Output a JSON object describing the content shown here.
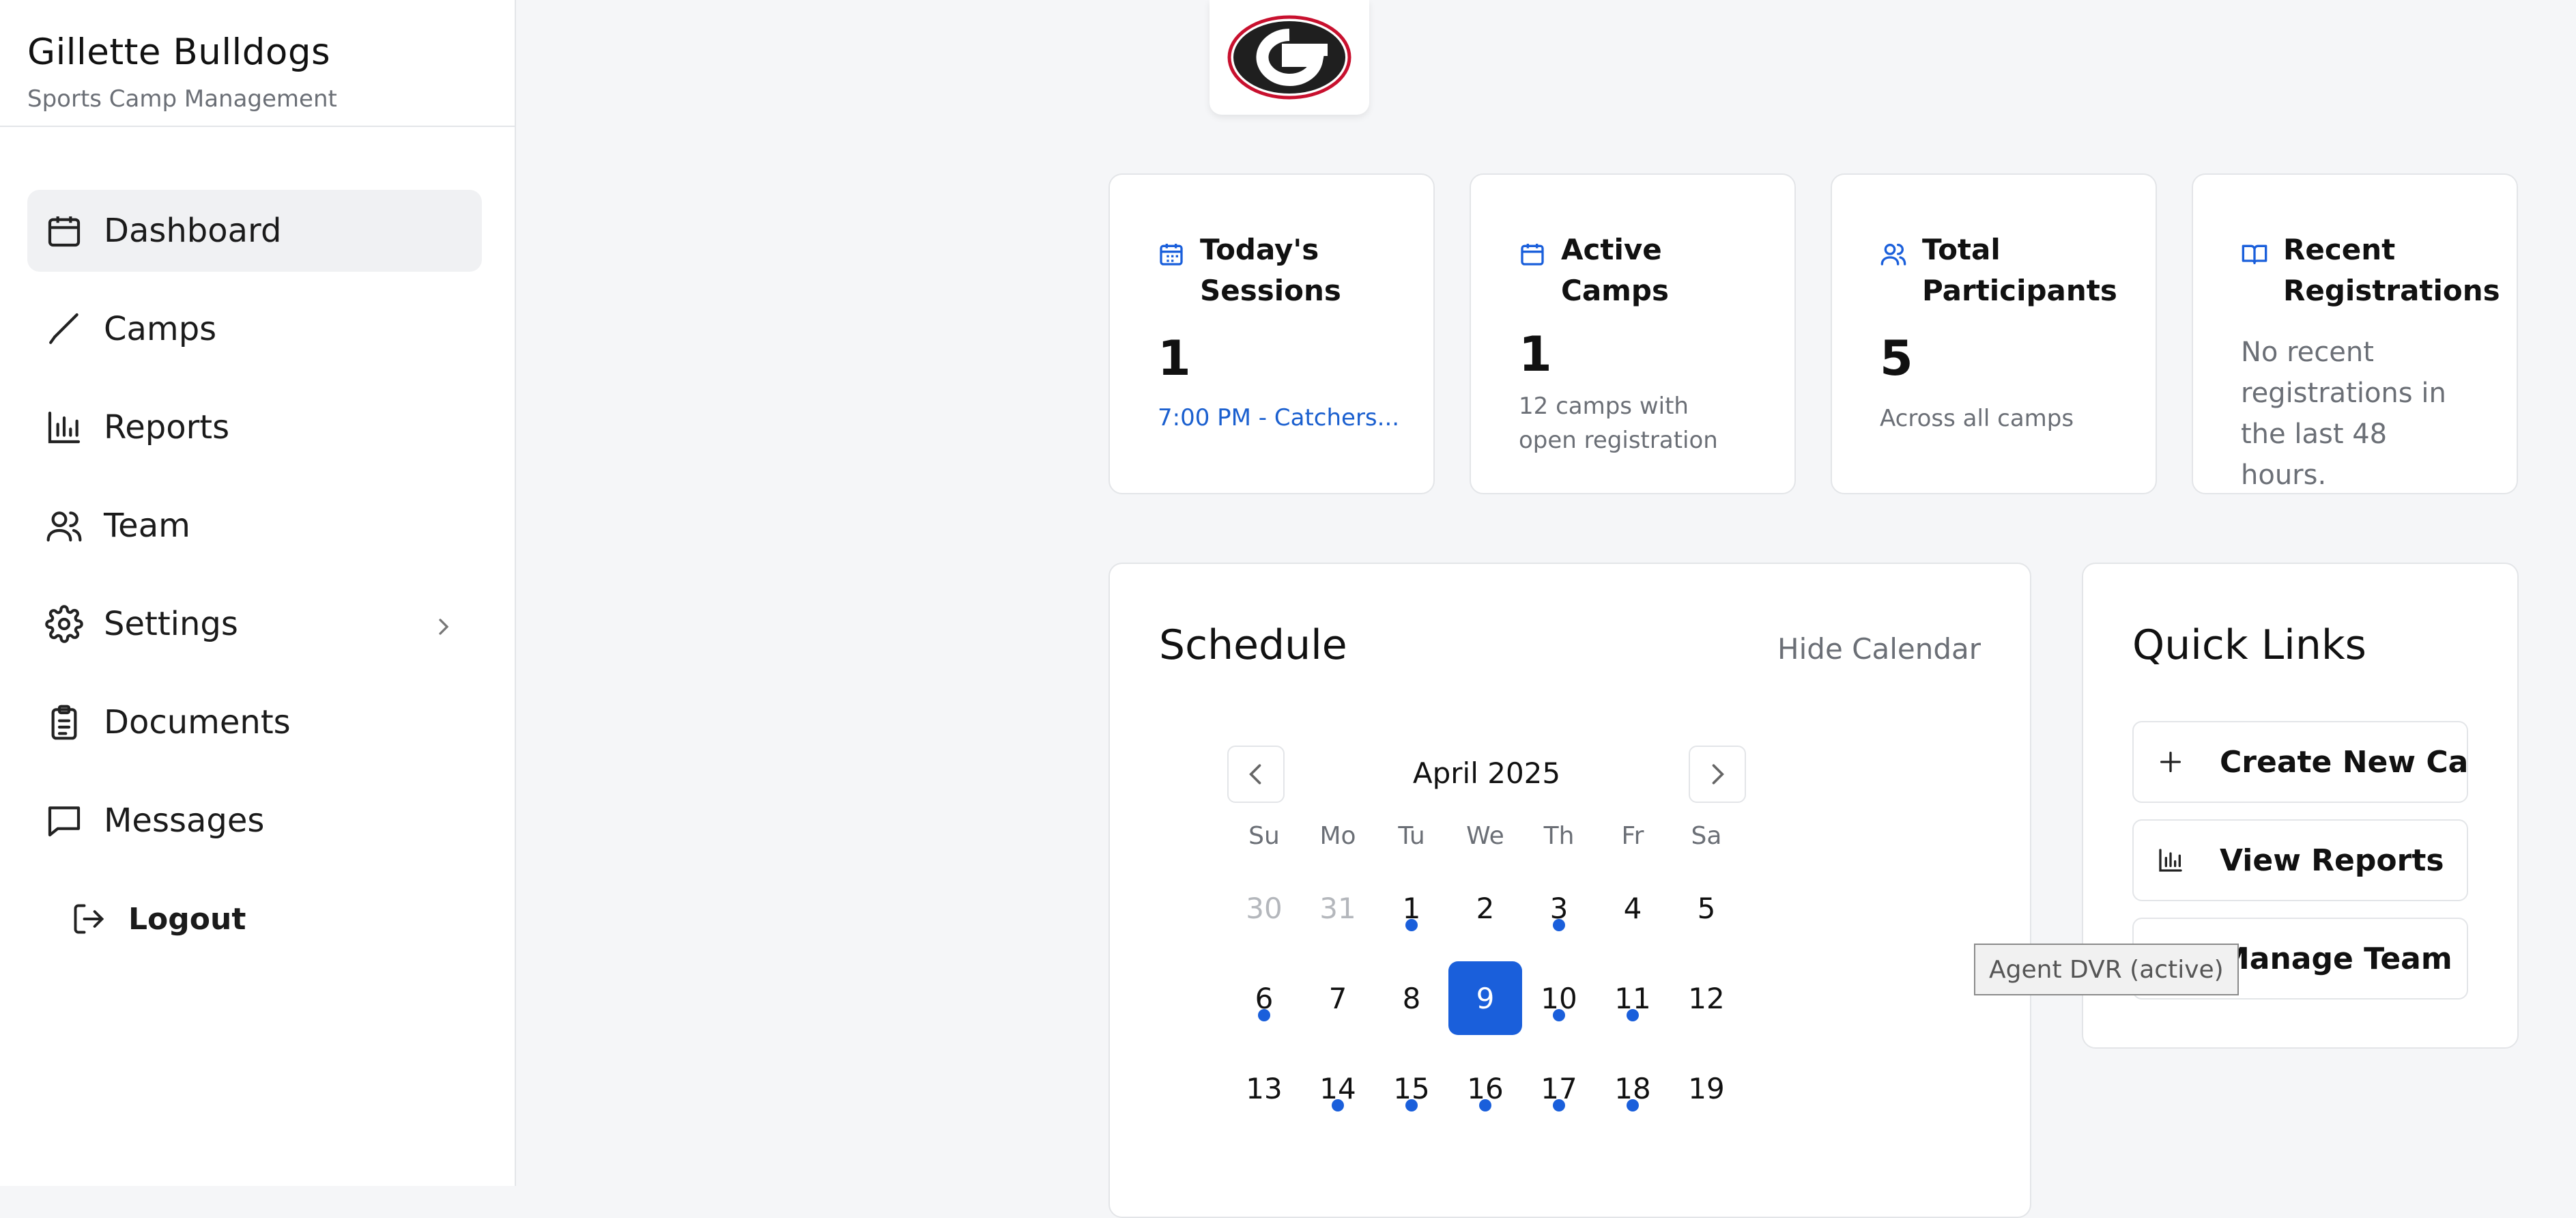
{
  "brand": {
    "title": "Gillette Bulldogs",
    "subtitle": "Sports Camp Management"
  },
  "sidebar": {
    "items": [
      {
        "label": "Dashboard",
        "icon": "calendar-icon"
      },
      {
        "label": "Camps",
        "icon": "bat-icon"
      },
      {
        "label": "Reports",
        "icon": "bar-chart-icon"
      },
      {
        "label": "Team",
        "icon": "users-icon"
      },
      {
        "label": "Settings",
        "icon": "gear-icon"
      },
      {
        "label": "Documents",
        "icon": "clipboard-icon"
      },
      {
        "label": "Messages",
        "icon": "message-icon"
      }
    ],
    "logout": "Logout"
  },
  "stats": {
    "todays_sessions": {
      "label": "Today's Sessions",
      "value": "1",
      "link": "7:00 PM - Catchers..."
    },
    "active_camps": {
      "label": "Active Camps",
      "value": "1",
      "note": "12 camps with open registration"
    },
    "total_participants": {
      "label": "Total Participants",
      "value": "5",
      "note": "Across all camps"
    },
    "recent_registrations": {
      "label": "Recent Registrations",
      "note": "No recent registrations in the last 48 hours."
    }
  },
  "schedule": {
    "title": "Schedule",
    "hide_label": "Hide Calendar",
    "month": "April 2025",
    "weekdays": [
      "Su",
      "Mo",
      "Tu",
      "We",
      "Th",
      "Fr",
      "Sa"
    ],
    "selected_day": "9",
    "days": [
      {
        "n": "30",
        "muted": true,
        "dot": false
      },
      {
        "n": "31",
        "muted": true,
        "dot": false
      },
      {
        "n": "1",
        "muted": false,
        "dot": true
      },
      {
        "n": "2",
        "muted": false,
        "dot": false
      },
      {
        "n": "3",
        "muted": false,
        "dot": true
      },
      {
        "n": "4",
        "muted": false,
        "dot": false
      },
      {
        "n": "5",
        "muted": false,
        "dot": false
      },
      {
        "n": "6",
        "muted": false,
        "dot": true
      },
      {
        "n": "7",
        "muted": false,
        "dot": false
      },
      {
        "n": "8",
        "muted": false,
        "dot": false
      },
      {
        "n": "9",
        "muted": false,
        "dot": false
      },
      {
        "n": "10",
        "muted": false,
        "dot": true
      },
      {
        "n": "11",
        "muted": false,
        "dot": true
      },
      {
        "n": "12",
        "muted": false,
        "dot": false
      },
      {
        "n": "13",
        "muted": false,
        "dot": false
      },
      {
        "n": "14",
        "muted": false,
        "dot": true
      },
      {
        "n": "15",
        "muted": false,
        "dot": true
      },
      {
        "n": "16",
        "muted": false,
        "dot": true
      },
      {
        "n": "17",
        "muted": false,
        "dot": true
      },
      {
        "n": "18",
        "muted": false,
        "dot": true
      },
      {
        "n": "19",
        "muted": false,
        "dot": false
      }
    ]
  },
  "quick_links": {
    "title": "Quick Links",
    "items": [
      {
        "label": "Create New Camp",
        "icon": "plus-icon"
      },
      {
        "label": "View Reports",
        "icon": "bar-chart-icon"
      },
      {
        "label": "Manage Team",
        "icon": "users-icon"
      }
    ]
  },
  "tooltip": "Agent DVR (active)",
  "colors": {
    "accent": "#1a5fdb",
    "logo": "#1f1f1f",
    "logo_ring": "#c8102e"
  }
}
